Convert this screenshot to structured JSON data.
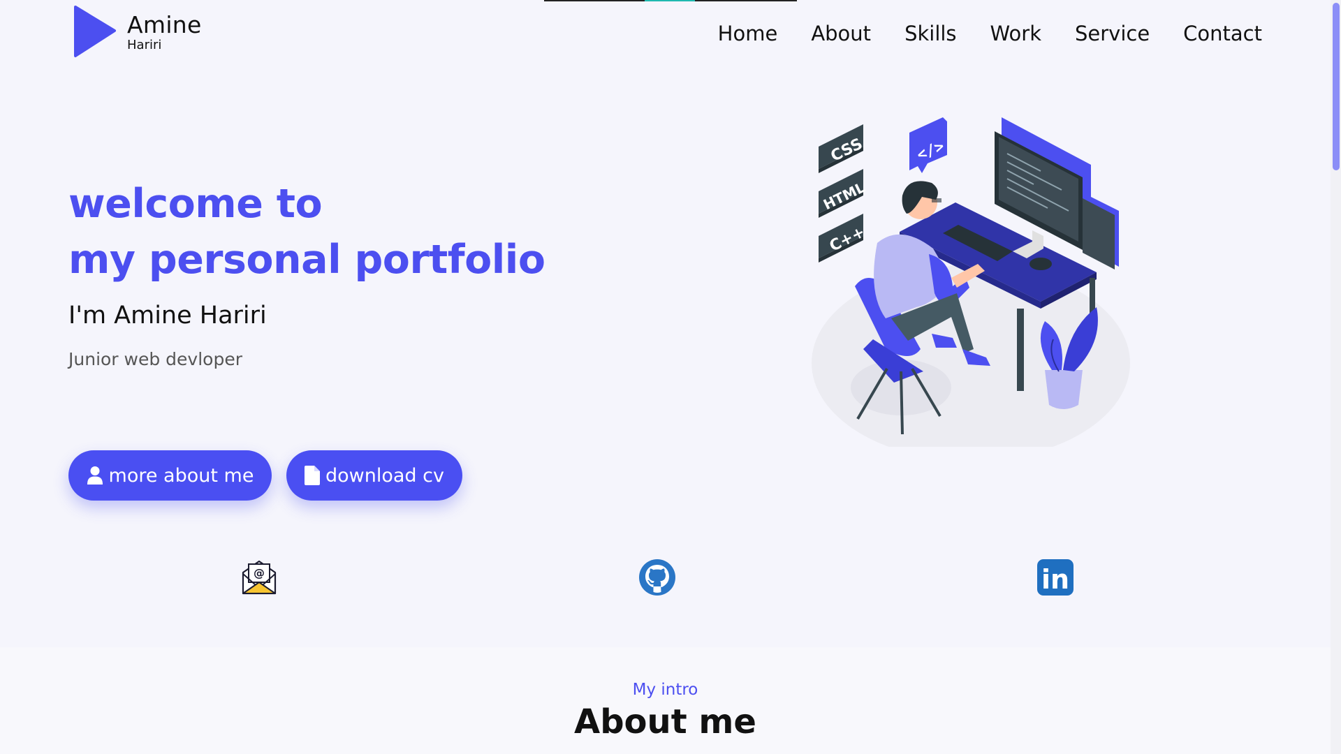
{
  "brand": {
    "first_name": "Amine",
    "last_name": "Hariri",
    "accent": "#4c4ff0"
  },
  "nav": {
    "items": [
      {
        "label": "Home"
      },
      {
        "label": "About"
      },
      {
        "label": "Skills"
      },
      {
        "label": "Work"
      },
      {
        "label": "Service"
      },
      {
        "label": "Contact"
      }
    ]
  },
  "hero": {
    "title_line1": "welcome to",
    "title_line2": "my personal portfolio",
    "name": "I'm Amine Hariri",
    "role": "Junior web devloper",
    "buttons": {
      "about_label": "more about me",
      "about_icon": "user-icon",
      "cv_label": "download cv",
      "cv_icon": "file-icon"
    },
    "illustration": {
      "tags": [
        "CSS",
        "HTML",
        "C++"
      ],
      "code_badge": "</>"
    }
  },
  "social": {
    "mail_icon": "envelope-at-icon",
    "github_icon": "github-icon",
    "linkedin_icon": "linkedin-icon",
    "mail_symbol": "@",
    "linkedin_text": "in"
  },
  "about": {
    "kicker": "My intro",
    "title": "About me"
  },
  "colors": {
    "primary": "#4a4ff2",
    "background": "#f5f5fc",
    "section_bg": "#f8f8fc",
    "scroll_thumb": "#8b8ef7"
  }
}
